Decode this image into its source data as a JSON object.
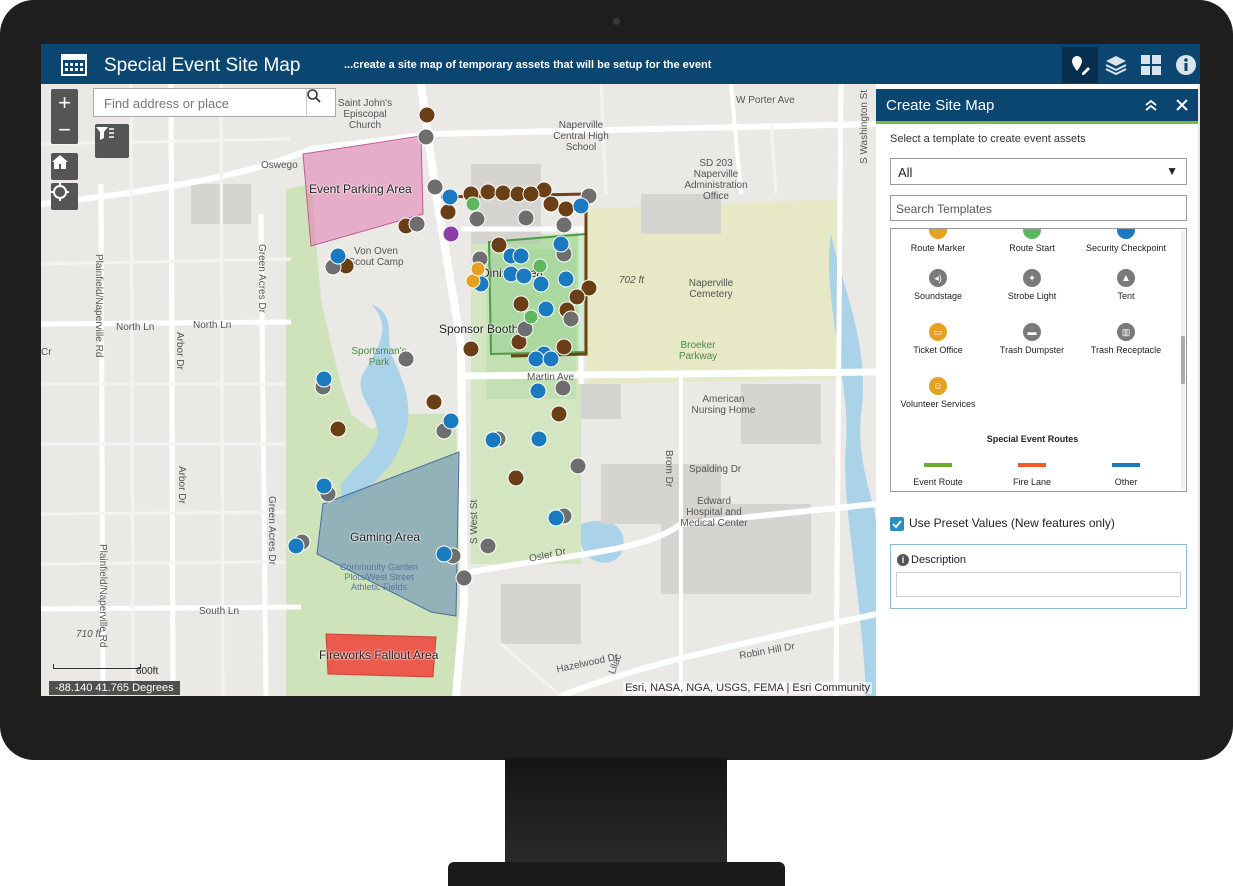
{
  "app": {
    "title": "Special Event Site Map",
    "subtitle": "...create a site map of temporary assets that will be setup for the event",
    "icons": [
      "calendar-icon",
      "edit-map-icon",
      "layers-icon",
      "grid-icon",
      "info-icon"
    ]
  },
  "map": {
    "search_placeholder": "Find address or place",
    "zoom_in": "+",
    "zoom_out": "−",
    "areas": {
      "parking": "Event Parking Area",
      "dining": "Dining Area",
      "sponsor": "Sponsor Booth",
      "gaming": "Gaming Area",
      "fireworks": "Fireworks Fallout Area"
    },
    "places": {
      "church": "Saint John's Episcopal Church",
      "school": "Naperville Central High School",
      "sd203": "SD 203 Naperville Administration Office",
      "scout": "Von Oven Scout Camp",
      "sportsman": "Sportsman's Park",
      "cemetery": "Naperville Cemetery",
      "broeker": "Broeker Parkway",
      "nursing": "American Nursing Home",
      "hospital": "Edward Hospital and Medical Center",
      "garden": "Community Garden Plots/West Street Athletic Fields",
      "elev702": "702 ft",
      "elev710": "710 ft"
    },
    "streets": {
      "porter": "W Porter Ave",
      "oswego": "Oswego",
      "washington": "S Washington St",
      "north_ln": "North Ln",
      "north_ln2": "North Ln",
      "green_acres": "Green Acres Dr",
      "green_acres2": "Green Acres Dr",
      "plainfield": "Plainfield/Naperville Rd",
      "plainfield2": "Plainfield/Naperville Rd",
      "arbor": "Arbor Dr",
      "arbor2": "Arbor Dr",
      "martin": "Martin Ave",
      "spalding": "Spalding Dr",
      "brom": "Brom Dr",
      "osler": "Osler Dr",
      "south_ln": "South Ln",
      "west_st": "S West St",
      "hazelwood": "Hazelwood Dr",
      "lilac": "Lilac",
      "robin": "Robin Hill Dr",
      "cr": "Cr"
    },
    "coords": "-88.140 41.765 Degrees",
    "scale": "600ft",
    "attribution": "Esri, NASA, NGA, USGS, FEMA | Esri Community"
  },
  "panel": {
    "title": "Create Site Map",
    "instruction": "Select a template to create event assets",
    "filter_value": "All",
    "search_placeholder": "Search Templates",
    "templates": [
      {
        "label": "Route Marker",
        "color": "#e5a11f"
      },
      {
        "label": "Route Start",
        "color": "#5cb85c"
      },
      {
        "label": "Security Checkpoint",
        "color": "#1a7abf"
      },
      {
        "label": "Soundstage",
        "color": "#7a7a7a"
      },
      {
        "label": "Strobe Light",
        "color": "#7a7a7a"
      },
      {
        "label": "Tent",
        "color": "#7a7a7a"
      },
      {
        "label": "Ticket Office",
        "color": "#e5a11f"
      },
      {
        "label": "Trash Dumpster",
        "color": "#7a7a7a"
      },
      {
        "label": "Trash Receptacle",
        "color": "#7a7a7a"
      },
      {
        "label": "Volunteer Services",
        "color": "#e5a11f"
      }
    ],
    "routes_heading": "Special Event Routes",
    "routes": [
      {
        "label": "Event Route",
        "color": "#6aab2e"
      },
      {
        "label": "Fire Lane",
        "color": "#f05a28"
      },
      {
        "label": "Other",
        "color": "#1a7abf"
      }
    ],
    "preset_label": "Use Preset Values (New features only)",
    "description_label": "Description"
  }
}
